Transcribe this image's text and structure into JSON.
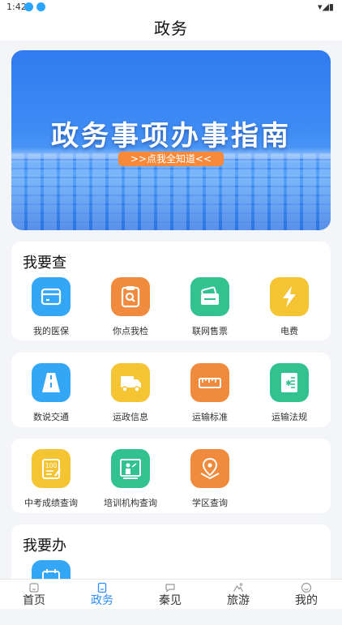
{
  "status": {
    "time": "1:42"
  },
  "header": {
    "title": "政务"
  },
  "banner": {
    "title": "政务事项办事指南",
    "button": ">>点我全知道<<"
  },
  "sections": {
    "query": {
      "title": "我要查"
    },
    "do": {
      "title": "我要办"
    }
  },
  "row1": [
    {
      "label": "我的医保",
      "color": "#33a7f5",
      "icon": "card-icon"
    },
    {
      "label": "你点我检",
      "color": "#f08a3d",
      "icon": "clipboard-search-icon"
    },
    {
      "label": "联网售票",
      "color": "#32c28f",
      "icon": "ticket-icon"
    },
    {
      "label": "电费",
      "color": "#f5c433",
      "icon": "lightning-icon"
    }
  ],
  "row2": [
    {
      "label": "数说交通",
      "color": "#33a7f5",
      "icon": "road-icon"
    },
    {
      "label": "运政信息",
      "color": "#f5c433",
      "icon": "truck-icon"
    },
    {
      "label": "运输标准",
      "color": "#f08a3d",
      "icon": "ruler-icon"
    },
    {
      "label": "运输法规",
      "color": "#32c28f",
      "icon": "law-book-icon"
    }
  ],
  "row3": [
    {
      "label": "中考成绩查询",
      "color": "#f5c433",
      "icon": "score-note-icon"
    },
    {
      "label": "培训机构查询",
      "color": "#32c28f",
      "icon": "training-board-icon"
    },
    {
      "label": "学区查询",
      "color": "#f08a3d",
      "icon": "map-pin-icon"
    }
  ],
  "row4": [
    {
      "label": "",
      "color": "#33a7f5",
      "icon": "calendar-icon"
    }
  ],
  "tabs": [
    {
      "label": "首页",
      "icon": "home-icon"
    },
    {
      "label": "政务",
      "icon": "document-icon"
    },
    {
      "label": "秦见",
      "icon": "chat-icon"
    },
    {
      "label": "旅游",
      "icon": "mountain-icon"
    },
    {
      "label": "我的",
      "icon": "smile-icon"
    }
  ]
}
